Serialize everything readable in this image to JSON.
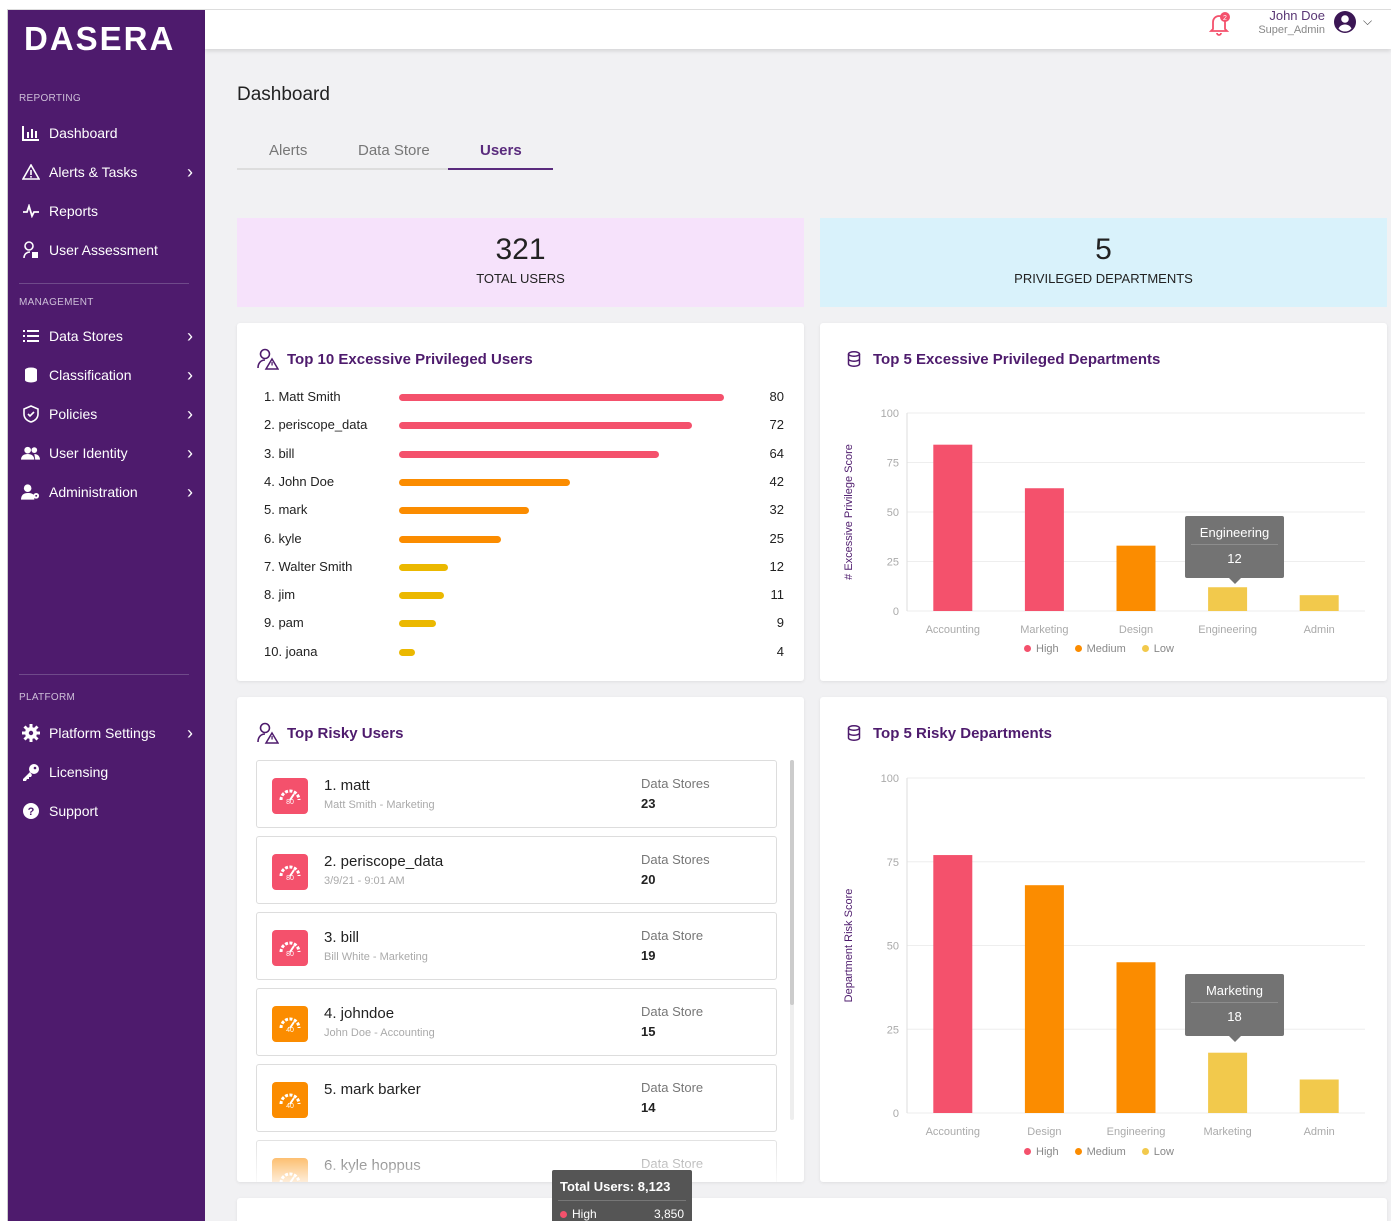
{
  "brand": "DASERA",
  "sidebar": {
    "reporting_label": "REPORTING",
    "management_label": "MANAGEMENT",
    "platform_label": "PLATFORM",
    "reporting": [
      {
        "label": "Dashboard",
        "icon": "bar-chart-icon"
      },
      {
        "label": "Alerts & Tasks",
        "icon": "warning-icon"
      },
      {
        "label": "Reports",
        "icon": "pulse-icon"
      },
      {
        "label": "User Assessment",
        "icon": "user-lock-icon"
      }
    ],
    "management": [
      {
        "label": "Data Stores",
        "icon": "list-icon"
      },
      {
        "label": "Classification",
        "icon": "database-icon"
      },
      {
        "label": "Policies",
        "icon": "shield-icon"
      },
      {
        "label": "User Identity",
        "icon": "users-icon"
      },
      {
        "label": "Administration",
        "icon": "user-cog-icon"
      }
    ],
    "platform": [
      {
        "label": "Platform Settings",
        "icon": "gear-icon"
      },
      {
        "label": "Licensing",
        "icon": "key-icon"
      },
      {
        "label": "Support",
        "icon": "help-icon"
      }
    ]
  },
  "header": {
    "user_name": "John Doe",
    "user_role": "Super_Admin",
    "notification_count": "2"
  },
  "page": {
    "title": "Dashboard"
  },
  "tabs": [
    "Alerts",
    "Data Store",
    "Users"
  ],
  "active_tab": "Users",
  "stats": {
    "total_users": "321",
    "total_users_label": "TOTAL USERS",
    "priv_depts": "5",
    "priv_depts_label": "PRIVILEGED DEPARTMENTS",
    "total_users_color": "#f6e2fb",
    "priv_depts_color": "#d9f2fb"
  },
  "top_users": {
    "title": "Top 10 Excessive Privileged Users",
    "rows": [
      {
        "name": "1. Matt Smith",
        "score": "80",
        "color": "#f4516c"
      },
      {
        "name": "2. periscope_data",
        "score": "72",
        "color": "#f4516c"
      },
      {
        "name": "3. bill",
        "score": "64",
        "color": "#f4516c"
      },
      {
        "name": "4. John Doe",
        "score": "42",
        "color": "#fb8c00"
      },
      {
        "name": "5. mark",
        "score": "32",
        "color": "#fb8c00"
      },
      {
        "name": "6. kyle",
        "score": "25",
        "color": "#fb8c00"
      },
      {
        "name": "7. Walter Smith",
        "score": "12",
        "color": "#ebb800"
      },
      {
        "name": "8. jim",
        "score": "11",
        "color": "#ebb800"
      },
      {
        "name": "9. pam",
        "score": "9",
        "color": "#ebb800"
      },
      {
        "name": "10. joana",
        "score": "4",
        "color": "#ebb800"
      }
    ]
  },
  "top_depts": {
    "title": "Top 5 Excessive Privileged Departments",
    "tooltip_label": "Engineering",
    "tooltip_value": "12"
  },
  "risky_users": {
    "title": "Top Risky Users",
    "items": [
      {
        "name": "1. matt",
        "sub": "Matt Smith - Marketing",
        "ds_label": "Data Stores",
        "ds_value": "23",
        "gauge": "80",
        "color": "#f4516c"
      },
      {
        "name": "2. periscope_data",
        "sub": "3/9/21 - 9:01 AM",
        "ds_label": "Data Stores",
        "ds_value": "20",
        "gauge": "80",
        "color": "#f4516c"
      },
      {
        "name": "3. bill",
        "sub": "Bill White - Marketing",
        "ds_label": "Data Store",
        "ds_value": "19",
        "gauge": "80",
        "color": "#f4516c"
      },
      {
        "name": "4. johndoe",
        "sub": "John Doe - Accounting",
        "ds_label": "Data Store",
        "ds_value": "15",
        "gauge": "40",
        "color": "#fb8c00"
      },
      {
        "name": "5. mark barker",
        "sub": "",
        "ds_label": "Data Store",
        "ds_value": "14",
        "gauge": "40",
        "color": "#fb8c00"
      },
      {
        "name": "6. kyle hoppus",
        "sub": "",
        "ds_label": "Data Store",
        "ds_value": "",
        "gauge": "",
        "color": "#fb8c00"
      }
    ]
  },
  "risky_depts": {
    "title": "Top 5 Risky Departments",
    "tooltip_label": "Marketing",
    "tooltip_value": "18"
  },
  "bottom_tooltip": {
    "title": "Total Users: 8,123",
    "row_label": "High",
    "row_value": "3,850"
  },
  "legend": {
    "high": "High",
    "medium": "Medium",
    "low": "Low"
  },
  "chart_data": [
    {
      "type": "bar",
      "title": "Top 5 Excessive Privileged Departments",
      "ylabel": "# Excessive Privilege Score",
      "categories": [
        "Accounting",
        "Marketing",
        "Design",
        "Engineering",
        "Admin"
      ],
      "values": [
        84,
        62,
        33,
        12,
        8
      ],
      "levels": [
        "High",
        "High",
        "Medium",
        "Low",
        "Low"
      ],
      "ylim": [
        0,
        100
      ],
      "yticks": [
        0,
        25,
        50,
        75,
        100
      ],
      "legend": [
        "High",
        "Medium",
        "Low"
      ]
    },
    {
      "type": "bar",
      "title": "Top 5 Risky Departments",
      "ylabel": "Department Risk Score",
      "categories": [
        "Accounting",
        "Design",
        "Engineering",
        "Marketing",
        "Admin"
      ],
      "values": [
        77,
        68,
        45,
        18,
        10
      ],
      "levels": [
        "High",
        "Medium",
        "Medium",
        "Low",
        "Low"
      ],
      "ylim": [
        0,
        100
      ],
      "yticks": [
        0,
        25,
        50,
        75,
        100
      ],
      "legend": [
        "High",
        "Medium",
        "Low"
      ]
    },
    {
      "type": "bar",
      "title": "Top 10 Excessive Privileged Users",
      "categories": [
        "Matt Smith",
        "periscope_data",
        "bill",
        "John Doe",
        "mark",
        "kyle",
        "Walter Smith",
        "jim",
        "pam",
        "joana"
      ],
      "values": [
        80,
        72,
        64,
        42,
        32,
        25,
        12,
        11,
        9,
        4
      ]
    }
  ],
  "colors": {
    "high": "#f4516c",
    "medium": "#fb8c00",
    "low": "#ebb800",
    "low_light": "#f2c94c",
    "brand": "#4e1b6d"
  }
}
